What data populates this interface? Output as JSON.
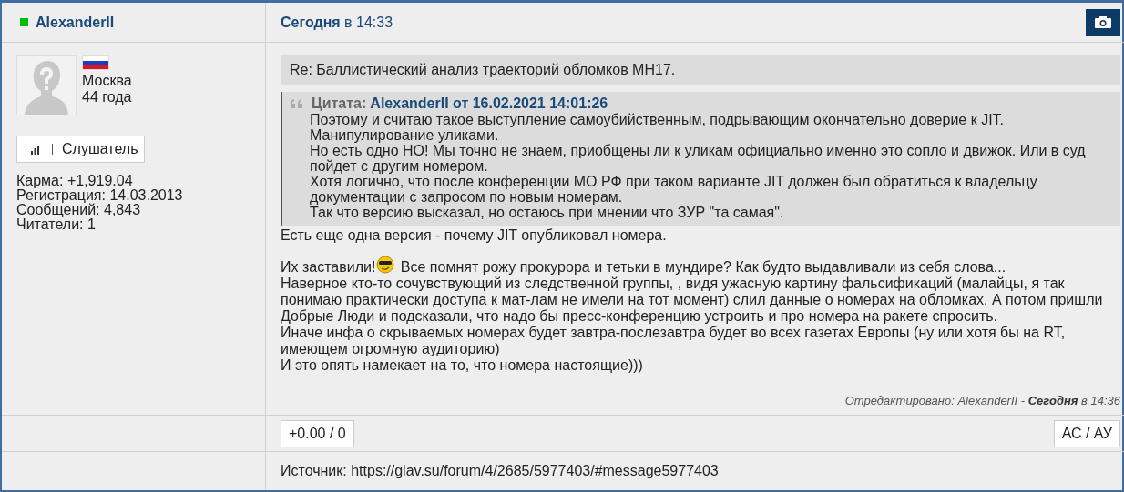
{
  "author": {
    "name": "AlexanderII",
    "online": true,
    "city": "Москва",
    "age": "44 года",
    "rank": "Слушатель",
    "stats": [
      "Карма: +1,919.04",
      "Регистрация: 14.03.2013",
      "Сообщений: 4,843",
      "Читатели: 1"
    ]
  },
  "post": {
    "date": "**Сегодня** в 14:33",
    "title": "Re: Баллистический анализ траекторий обломков МН17.",
    "quote": {
      "label": "Цитата:",
      "source": "AlexanderII от 16.02.2021 14:01:26",
      "lines": [
        "Поэтому и считаю такое выступление самоубийственным, подрывающим окончательно доверие к JIT.",
        "Манипулирование уликами.",
        "Но есть одно НО! Мы точно не знаем, приобщены ли к уликам официально именно это сопло и движок. Или в суд пойдет с другим номером.",
        "Хотя логично, что после конференции МО РФ при таком варианте JIT должен был обратиться к владельцу документации с запросом по новым номерам.",
        "Так что версию высказал, но остаюсь при мнении что ЗУР \"та самая\"."
      ]
    },
    "body": [
      {
        "kind": "text",
        "text": "Есть еще одна версия - почему JIT опубликовал номера."
      },
      {
        "kind": "gap"
      },
      {
        "kind": "smiley",
        "before": "Их заставили!",
        "after": "Все помнят рожу прокурора и тетьки в мундире? Как будто выдавливали из себя слова..."
      },
      {
        "kind": "text",
        "text": "Наверное кто-то сочувствующий из следственной группы, , видя ужасную картину фальсификаций (малайцы, я так понимаю практически доступа к мат-лам не имели на тот момент) слил данные о номерах на обломках. А потом пришли Добрые Люди и подсказали, что надо бы пресс-конференцию устроить и про номера на ракете спросить."
      },
      {
        "kind": "text",
        "text": "Иначе инфа о скрываемых номерах будет завтра-послезавтра будет во всех газетах Европы (ну или хотя бы на RT, имеющем огромную аудиторию)"
      },
      {
        "kind": "text",
        "text": "И это опять намекает на то, что номера настоящие)))"
      }
    ],
    "edited": "Отредактировано: AlexanderII - **Сегодня** в 14:36",
    "rating": "+0.00 / 0",
    "reply_button": "АС / АУ",
    "source": "Источник: https://glav.su/forum/4/2685/5977403/#message5977403"
  }
}
